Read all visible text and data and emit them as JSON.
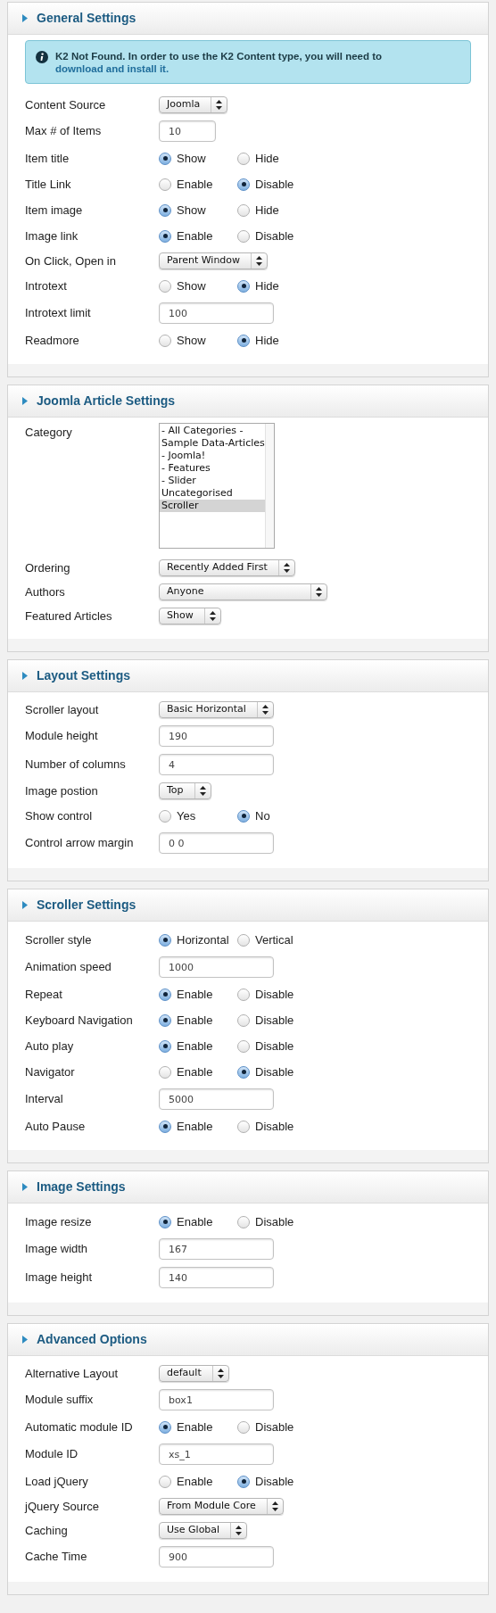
{
  "sections": [
    {
      "title": "General Settings",
      "notice": {
        "text": "K2 Not Found. In order to use the K2 Content type, you will need to ",
        "link": "download and install it."
      },
      "rows": [
        {
          "kind": "select",
          "label": "Content Source",
          "value": "Joomla"
        },
        {
          "kind": "short-text",
          "label": "Max # of Items",
          "value": "10"
        },
        {
          "kind": "radio",
          "label": "Item title",
          "options": [
            {
              "label": "Show",
              "selected": true
            },
            {
              "label": "Hide",
              "selected": false
            }
          ]
        },
        {
          "kind": "radio",
          "label": "Title Link",
          "options": [
            {
              "label": "Enable",
              "selected": false
            },
            {
              "label": "Disable",
              "selected": true
            }
          ]
        },
        {
          "kind": "radio",
          "label": "Item image",
          "options": [
            {
              "label": "Show",
              "selected": true
            },
            {
              "label": "Hide",
              "selected": false
            }
          ]
        },
        {
          "kind": "radio",
          "label": "Image link",
          "options": [
            {
              "label": "Enable",
              "selected": true
            },
            {
              "label": "Disable",
              "selected": false
            }
          ]
        },
        {
          "kind": "select",
          "label": "On Click, Open in",
          "value": "Parent Window"
        },
        {
          "kind": "radio",
          "label": "Introtext",
          "options": [
            {
              "label": "Show",
              "selected": false
            },
            {
              "label": "Hide",
              "selected": true
            }
          ]
        },
        {
          "kind": "text",
          "label": "Introtext limit",
          "value": "100"
        },
        {
          "kind": "radio",
          "label": "Readmore",
          "options": [
            {
              "label": "Show",
              "selected": false
            },
            {
              "label": "Hide",
              "selected": true
            }
          ]
        }
      ]
    },
    {
      "title": "Joomla Article Settings",
      "rows": [
        {
          "kind": "listbox",
          "label": "Category",
          "items": [
            {
              "label": "- All Categories -",
              "selected": false
            },
            {
              "label": "Sample Data-Articles",
              "selected": false
            },
            {
              "label": "- Joomla!",
              "selected": false
            },
            {
              "label": "- Features",
              "selected": false
            },
            {
              "label": "- Slider",
              "selected": false
            },
            {
              "label": "Uncategorised",
              "selected": false
            },
            {
              "label": "Scroller",
              "selected": true
            }
          ]
        },
        {
          "kind": "select",
          "label": "Ordering",
          "value": "Recently Added First"
        },
        {
          "kind": "wide-select",
          "label": "Authors",
          "value": "Anyone"
        },
        {
          "kind": "select",
          "label": "Featured Articles",
          "value": "Show"
        }
      ]
    },
    {
      "title": "Layout Settings",
      "rows": [
        {
          "kind": "select",
          "label": "Scroller layout",
          "value": "Basic Horizontal"
        },
        {
          "kind": "text",
          "label": "Module height",
          "value": "190"
        },
        {
          "kind": "text",
          "label": "Number of columns",
          "value": "4"
        },
        {
          "kind": "select",
          "label": "Image postion",
          "value": "Top"
        },
        {
          "kind": "radio",
          "label": "Show control",
          "options": [
            {
              "label": "Yes",
              "selected": false
            },
            {
              "label": "No",
              "selected": true
            }
          ]
        },
        {
          "kind": "text",
          "label": "Control arrow margin",
          "value": "0 0"
        }
      ]
    },
    {
      "title": "Scroller Settings",
      "rows": [
        {
          "kind": "radio",
          "label": "Scroller style",
          "options": [
            {
              "label": "Horizontal",
              "selected": true
            },
            {
              "label": "Vertical",
              "selected": false
            }
          ]
        },
        {
          "kind": "text",
          "label": "Animation speed",
          "value": "1000"
        },
        {
          "kind": "radio",
          "label": "Repeat",
          "options": [
            {
              "label": "Enable",
              "selected": true
            },
            {
              "label": "Disable",
              "selected": false
            }
          ]
        },
        {
          "kind": "radio",
          "label": "Keyboard Navigation",
          "options": [
            {
              "label": "Enable",
              "selected": true
            },
            {
              "label": "Disable",
              "selected": false
            }
          ]
        },
        {
          "kind": "radio",
          "label": "Auto play",
          "options": [
            {
              "label": "Enable",
              "selected": true
            },
            {
              "label": "Disable",
              "selected": false
            }
          ]
        },
        {
          "kind": "radio",
          "label": "Navigator",
          "options": [
            {
              "label": "Enable",
              "selected": false
            },
            {
              "label": "Disable",
              "selected": true
            }
          ]
        },
        {
          "kind": "text",
          "label": "Interval",
          "value": "5000"
        },
        {
          "kind": "radio",
          "label": "Auto Pause",
          "options": [
            {
              "label": "Enable",
              "selected": true
            },
            {
              "label": "Disable",
              "selected": false
            }
          ]
        }
      ]
    },
    {
      "title": "Image Settings",
      "rows": [
        {
          "kind": "radio",
          "label": "Image resize",
          "options": [
            {
              "label": "Enable",
              "selected": true
            },
            {
              "label": "Disable",
              "selected": false
            }
          ]
        },
        {
          "kind": "text",
          "label": "Image width",
          "value": "167"
        },
        {
          "kind": "text",
          "label": "Image height",
          "value": "140"
        }
      ]
    },
    {
      "title": "Advanced Options",
      "rows": [
        {
          "kind": "select",
          "label": "Alternative Layout",
          "value": "default"
        },
        {
          "kind": "text",
          "label": "Module suffix",
          "value": "box1"
        },
        {
          "kind": "radio",
          "label": "Automatic module ID",
          "options": [
            {
              "label": "Enable",
              "selected": true
            },
            {
              "label": "Disable",
              "selected": false
            }
          ]
        },
        {
          "kind": "text",
          "label": "Module ID",
          "value": "xs_1"
        },
        {
          "kind": "radio",
          "label": "Load jQuery",
          "options": [
            {
              "label": "Enable",
              "selected": false
            },
            {
              "label": "Disable",
              "selected": true
            }
          ]
        },
        {
          "kind": "select",
          "label": "jQuery Source",
          "value": "From Module Core"
        },
        {
          "kind": "select",
          "label": "Caching",
          "value": "Use Global"
        },
        {
          "kind": "text",
          "label": "Cache Time",
          "value": "900"
        }
      ]
    }
  ]
}
